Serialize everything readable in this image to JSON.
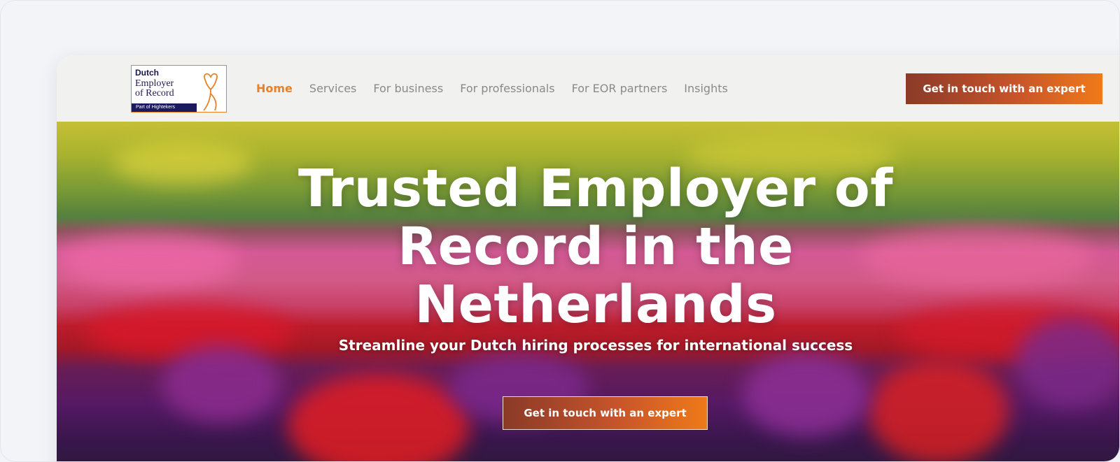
{
  "logo": {
    "line1": "Dutch",
    "line2": "Employer",
    "line3": "of Record",
    "part_of": "Part of  Hightekers"
  },
  "nav": {
    "items": [
      {
        "label": "Home",
        "active": true
      },
      {
        "label": "Services",
        "active": false
      },
      {
        "label": "For business",
        "active": false
      },
      {
        "label": "For professionals",
        "active": false
      },
      {
        "label": "For EOR partners",
        "active": false
      },
      {
        "label": "Insights",
        "active": false
      }
    ]
  },
  "header_cta": "Get in touch with an expert",
  "hero": {
    "title_lines": [
      "Trusted Employer of",
      "Record in the",
      "Netherlands"
    ],
    "subtitle": "Streamline your Dutch hiring processes for international success",
    "cta": "Get in touch with an expert"
  },
  "colors": {
    "brand_orange": "#e8822a",
    "brand_navy": "#1b1a5c",
    "cta_gradient_start": "#8a3a28",
    "cta_gradient_end": "#ef7a1a"
  }
}
